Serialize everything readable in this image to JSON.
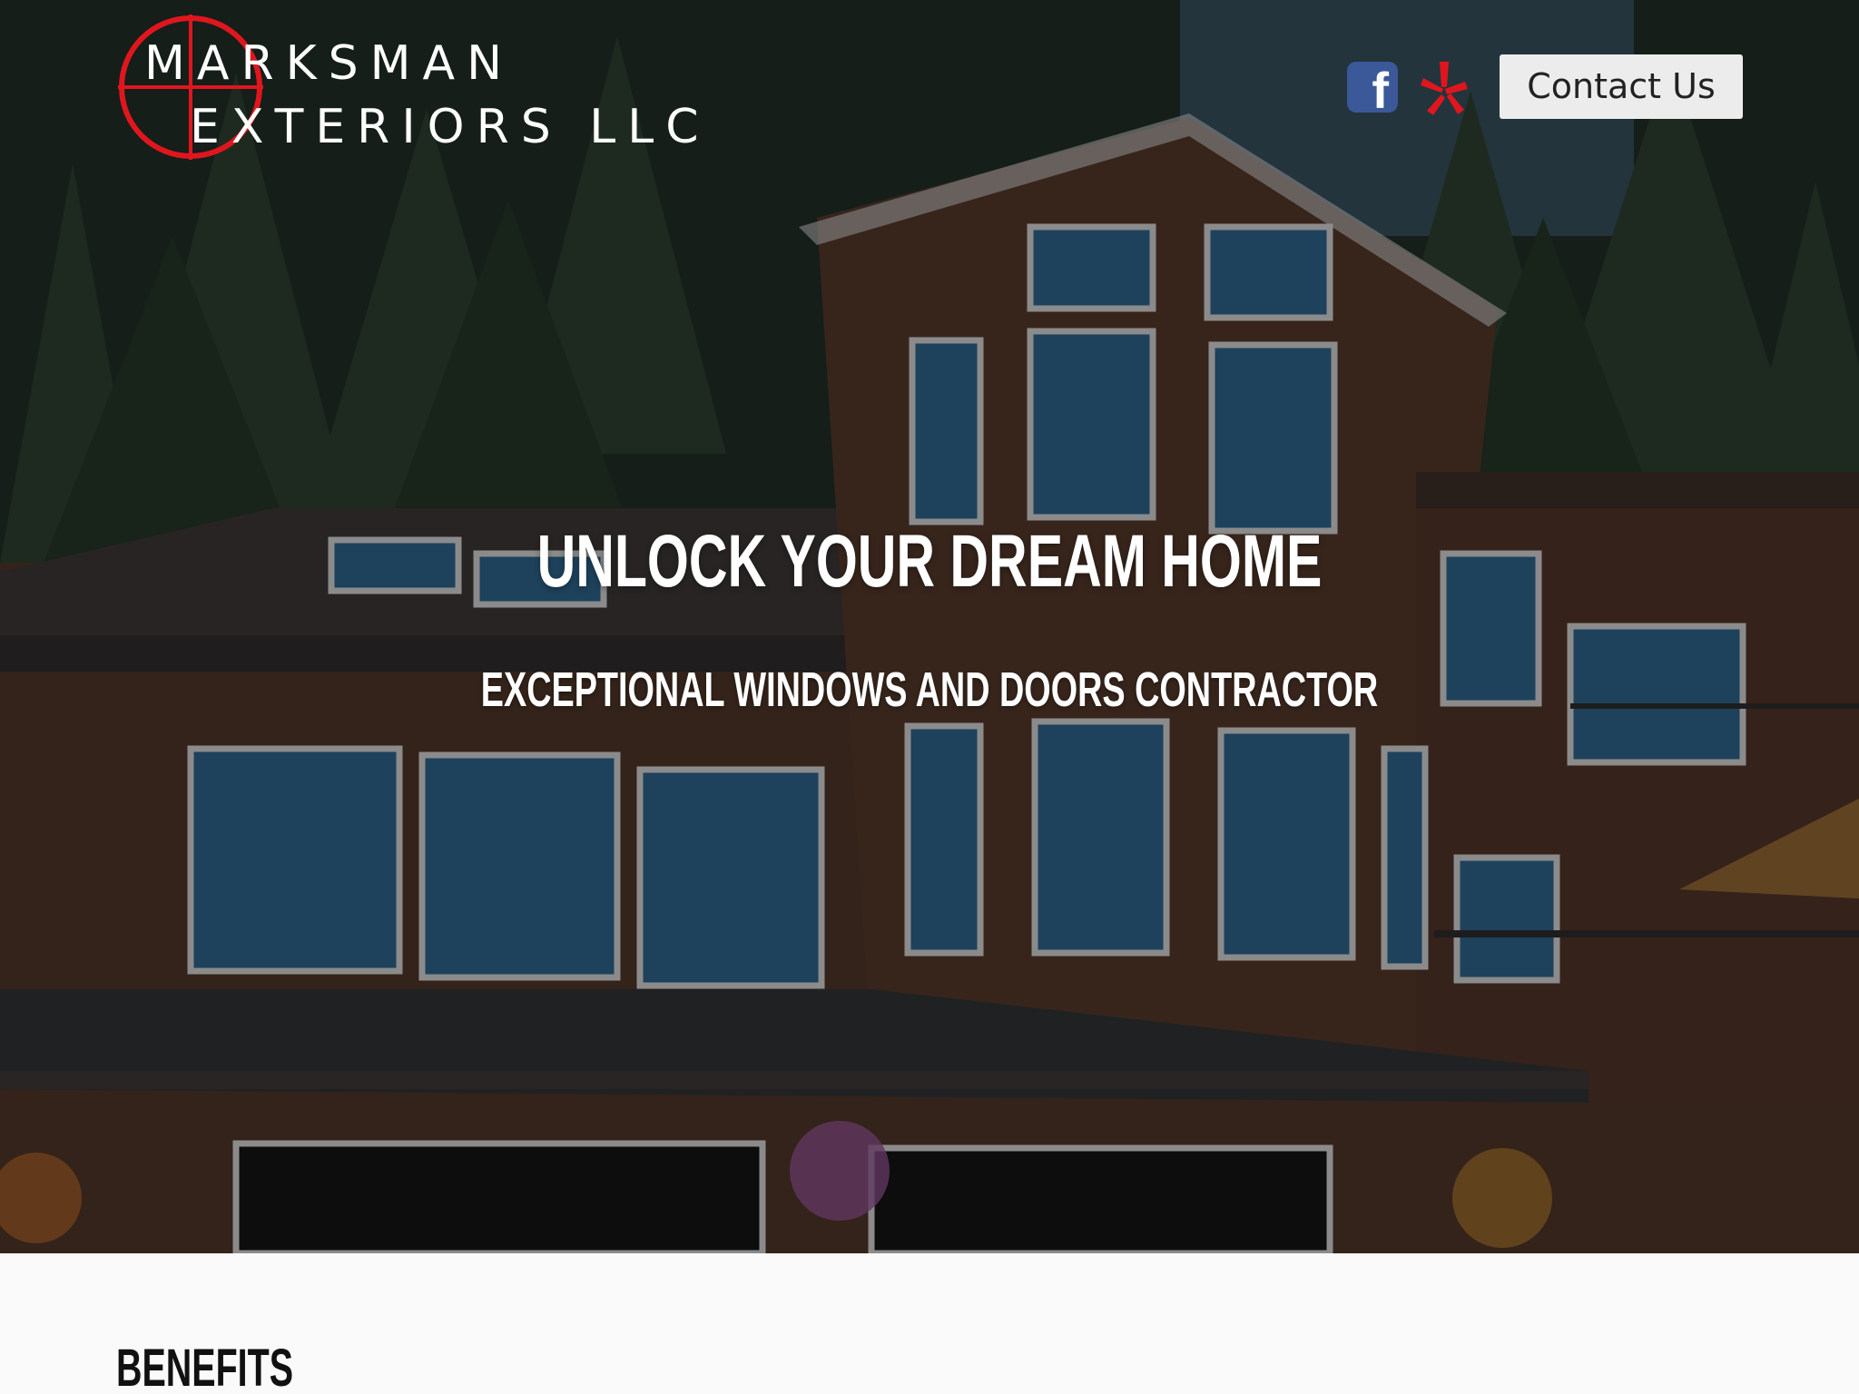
{
  "header": {
    "logo": {
      "line1": "MARKSMAN",
      "line2": "EXTERIORS LLC",
      "crosshair_color": "#e0161e"
    },
    "social": [
      {
        "name": "facebook-icon",
        "glyph": "f",
        "color": "#3b5998"
      },
      {
        "name": "yelp-icon",
        "color": "#e0161e"
      }
    ],
    "contact_button": "Contact Us"
  },
  "hero": {
    "title": "UNLOCK YOUR DREAM HOME",
    "subtitle": "EXCEPTIONAL WINDOWS AND DOORS CONTRACTOR"
  },
  "sections": {
    "benefits_heading": "BENEFITS"
  }
}
